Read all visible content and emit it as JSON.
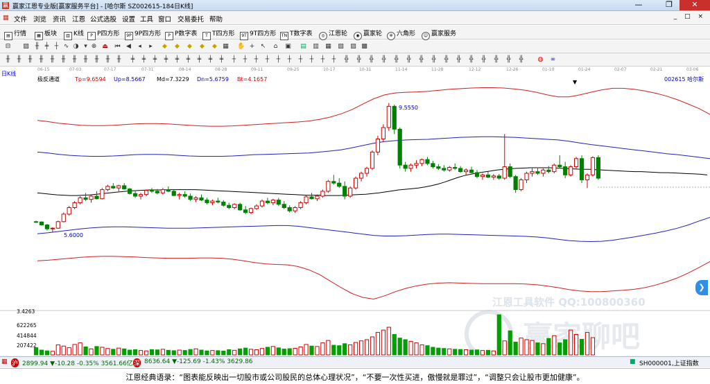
{
  "titlebar": {
    "title": "赢家江恩专业版[赢家服务平台] - [哈尔斯  SZ002615-184日K线]"
  },
  "menubar": {
    "items": [
      "文件",
      "浏览",
      "资讯",
      "江恩",
      "公式选股",
      "设置",
      "工具",
      "窗口",
      "交易委托",
      "帮助"
    ],
    "mdi": "_ □ ×"
  },
  "toolbar1": {
    "items": [
      "行情",
      "板块",
      "K线",
      "P四方形",
      "9P四方形",
      "P数字表",
      "T四方形",
      "9T四方形",
      "T数字表",
      "江恩轮",
      "赢家轮",
      "六角形",
      "赢家服务"
    ]
  },
  "datebar": {
    "dates": [
      "06-15",
      "07-03",
      "07-17",
      "07-31",
      "08-14",
      "08-28",
      "09-11",
      "09-25",
      "10-17",
      "10-31",
      "11-14",
      "11-28",
      "12-12",
      "12-26",
      "01-10",
      "01-24",
      "02-07",
      "02-21",
      "03-06"
    ]
  },
  "period_label": "日K线",
  "chart_data": {
    "type": "candlestick",
    "indicator": {
      "name": "极反通道",
      "params": [
        {
          "label": "Tp",
          "value": "9.6594",
          "color": "#e00000"
        },
        {
          "label": "Up",
          "value": "8.5667",
          "color": "#0000c0"
        },
        {
          "label": "Md",
          "value": "7.3229",
          "color": "#000000"
        },
        {
          "label": "Dn",
          "value": "5.6759",
          "color": "#0000c0"
        },
        {
          "label": "Bt",
          "value": "4.1657",
          "color": "#e00000"
        }
      ]
    },
    "stock_label": "002615 哈尔斯",
    "annotations": {
      "high": "9.5550",
      "low": "5.6000"
    },
    "price_axis": {
      "top": 10.2,
      "bottom": 3.2
    },
    "candles": [
      [
        5.92,
        5.95,
        5.88,
        5.91
      ],
      [
        5.91,
        5.93,
        5.8,
        5.82
      ],
      [
        5.82,
        5.85,
        5.65,
        5.7
      ],
      [
        5.7,
        5.75,
        5.6,
        5.72
      ],
      [
        5.72,
        5.95,
        5.7,
        5.92
      ],
      [
        5.92,
        6.2,
        5.9,
        6.15
      ],
      [
        6.15,
        6.4,
        6.1,
        6.35
      ],
      [
        6.35,
        6.55,
        6.3,
        6.5
      ],
      [
        6.5,
        6.7,
        6.45,
        6.65
      ],
      [
        6.65,
        6.8,
        6.55,
        6.6
      ],
      [
        6.6,
        6.75,
        6.5,
        6.7
      ],
      [
        6.7,
        6.85,
        6.6,
        6.62
      ],
      [
        6.62,
        6.95,
        6.6,
        6.9
      ],
      [
        6.9,
        7.05,
        6.85,
        7.0
      ],
      [
        7.0,
        7.1,
        6.92,
        6.95
      ],
      [
        6.95,
        7.05,
        6.85,
        7.02
      ],
      [
        7.02,
        7.1,
        6.9,
        6.92
      ],
      [
        6.92,
        6.95,
        6.75,
        6.78
      ],
      [
        6.78,
        6.85,
        6.65,
        6.7
      ],
      [
        6.7,
        6.8,
        6.6,
        6.75
      ],
      [
        6.75,
        6.9,
        6.7,
        6.88
      ],
      [
        6.88,
        6.95,
        6.8,
        6.85
      ],
      [
        6.85,
        6.92,
        6.75,
        6.8
      ],
      [
        6.8,
        6.95,
        6.75,
        6.9
      ],
      [
        6.9,
        7.0,
        6.82,
        6.85
      ],
      [
        6.85,
        6.9,
        6.7,
        6.72
      ],
      [
        6.72,
        6.8,
        6.6,
        6.75
      ],
      [
        6.75,
        6.85,
        6.65,
        6.7
      ],
      [
        6.7,
        6.78,
        6.55,
        6.6
      ],
      [
        6.6,
        6.7,
        6.52,
        6.65
      ],
      [
        6.65,
        6.75,
        6.55,
        6.58
      ],
      [
        6.58,
        6.65,
        6.45,
        6.5
      ],
      [
        6.5,
        6.6,
        6.42,
        6.55
      ],
      [
        6.55,
        6.65,
        6.48,
        6.52
      ],
      [
        6.52,
        6.58,
        6.38,
        6.42
      ],
      [
        6.42,
        6.5,
        6.3,
        6.35
      ],
      [
        6.35,
        6.48,
        6.3,
        6.45
      ],
      [
        6.45,
        6.5,
        6.25,
        6.28
      ],
      [
        6.28,
        6.4,
        6.15,
        6.2
      ],
      [
        6.2,
        6.35,
        6.15,
        6.32
      ],
      [
        6.32,
        6.45,
        6.28,
        6.4
      ],
      [
        6.4,
        6.6,
        6.35,
        6.55
      ],
      [
        6.55,
        6.65,
        6.45,
        6.5
      ],
      [
        6.5,
        6.62,
        6.42,
        6.58
      ],
      [
        6.58,
        6.65,
        6.4,
        6.45
      ],
      [
        6.45,
        6.55,
        6.3,
        6.35
      ],
      [
        6.35,
        6.42,
        6.2,
        6.25
      ],
      [
        6.25,
        6.4,
        6.18,
        6.35
      ],
      [
        6.35,
        6.55,
        6.3,
        6.5
      ],
      [
        6.5,
        6.72,
        6.45,
        6.68
      ],
      [
        6.68,
        6.8,
        6.6,
        6.62
      ],
      [
        6.62,
        6.75,
        6.55,
        6.7
      ],
      [
        6.7,
        6.9,
        6.65,
        6.85
      ],
      [
        6.85,
        7.2,
        6.8,
        7.15
      ],
      [
        7.15,
        7.35,
        7.05,
        7.1
      ],
      [
        7.1,
        7.25,
        6.95,
        7.0
      ],
      [
        7.0,
        7.15,
        6.6,
        6.7
      ],
      [
        6.7,
        7.0,
        6.65,
        6.95
      ],
      [
        6.95,
        7.3,
        6.9,
        7.25
      ],
      [
        7.25,
        7.45,
        7.15,
        7.4
      ],
      [
        7.4,
        7.6,
        7.3,
        7.55
      ],
      [
        7.55,
        8.1,
        7.5,
        8.05
      ],
      [
        8.05,
        8.55,
        7.95,
        8.45
      ],
      [
        8.45,
        8.9,
        8.35,
        8.8
      ],
      [
        8.8,
        9.55,
        8.7,
        9.45
      ],
      [
        9.45,
        9.5,
        8.6,
        8.75
      ],
      [
        8.75,
        8.8,
        7.55,
        7.65
      ],
      [
        7.65,
        7.75,
        7.45,
        7.55
      ],
      [
        7.55,
        7.7,
        7.45,
        7.65
      ],
      [
        7.65,
        7.8,
        7.55,
        7.7
      ],
      [
        7.7,
        7.85,
        7.62,
        7.82
      ],
      [
        7.82,
        7.9,
        7.65,
        7.7
      ],
      [
        7.7,
        7.78,
        7.55,
        7.6
      ],
      [
        7.6,
        7.68,
        7.5,
        7.55
      ],
      [
        7.55,
        7.65,
        7.45,
        7.5
      ],
      [
        7.5,
        7.62,
        7.45,
        7.58
      ],
      [
        7.58,
        7.7,
        7.5,
        7.55
      ],
      [
        7.55,
        7.62,
        7.42,
        7.45
      ],
      [
        7.45,
        7.55,
        7.35,
        7.5
      ],
      [
        7.5,
        7.6,
        7.4,
        7.42
      ],
      [
        7.42,
        7.5,
        7.25,
        7.3
      ],
      [
        7.3,
        7.4,
        7.2,
        7.35
      ],
      [
        7.35,
        7.45,
        7.25,
        7.28
      ],
      [
        7.28,
        7.38,
        7.2,
        7.32
      ],
      [
        7.32,
        7.38,
        7.2,
        7.25
      ],
      [
        7.25,
        8.6,
        7.2,
        7.6
      ],
      [
        7.6,
        7.7,
        7.25,
        7.3
      ],
      [
        7.3,
        7.35,
        6.8,
        6.9
      ],
      [
        6.9,
        7.25,
        6.85,
        7.2
      ],
      [
        7.2,
        7.45,
        7.1,
        7.4
      ],
      [
        7.4,
        7.55,
        7.3,
        7.45
      ],
      [
        7.45,
        7.58,
        7.35,
        7.4
      ],
      [
        7.4,
        7.55,
        7.3,
        7.5
      ],
      [
        7.5,
        7.62,
        7.4,
        7.45
      ],
      [
        7.45,
        7.7,
        7.4,
        7.65
      ],
      [
        7.65,
        7.95,
        7.55,
        7.6
      ],
      [
        7.6,
        7.75,
        7.25,
        7.35
      ],
      [
        7.35,
        7.65,
        7.3,
        7.6
      ],
      [
        7.6,
        7.9,
        7.55,
        7.85
      ],
      [
        7.85,
        7.95,
        7.1,
        7.2
      ],
      [
        7.2,
        7.4,
        6.95,
        7.35
      ],
      [
        7.35,
        7.92,
        7.3,
        7.88
      ],
      [
        7.88,
        7.95,
        7.2,
        7.25
      ]
    ],
    "md_line": [
      6.8,
      6.78,
      6.76,
      6.74,
      6.73,
      6.72,
      6.72,
      6.73,
      6.74,
      6.76,
      6.78,
      6.8,
      6.82,
      6.84,
      6.86,
      6.87,
      6.88,
      6.89,
      6.89,
      6.89,
      6.9,
      6.9,
      6.9,
      6.9,
      6.9,
      6.89,
      6.88,
      6.87,
      6.86,
      6.85,
      6.84,
      6.83,
      6.82,
      6.81,
      6.8,
      6.79,
      6.78,
      6.77,
      6.76,
      6.75,
      6.74,
      6.73,
      6.73,
      6.73,
      6.72,
      6.72,
      6.72,
      6.73,
      6.74,
      6.75,
      6.76,
      6.78,
      6.8,
      6.83,
      6.86,
      6.89,
      6.91,
      6.93,
      6.95,
      6.98,
      7.02,
      7.07,
      7.13,
      7.2,
      7.27,
      7.33,
      7.37,
      7.41,
      7.44,
      7.47,
      7.5,
      7.52,
      7.54,
      7.55,
      7.56,
      7.57,
      7.57,
      7.57,
      7.57,
      7.56,
      7.55,
      7.54,
      7.53,
      7.52,
      7.52,
      7.51,
      7.5,
      7.49,
      7.48,
      7.47,
      7.46,
      7.45,
      7.45,
      7.44,
      7.43,
      7.42,
      7.42,
      7.41,
      7.4,
      7.39,
      7.38,
      7.37,
      7.35
    ],
    "up_line": [
      8.05,
      8.02,
      7.98,
      7.95,
      7.93,
      7.92,
      7.92,
      7.93,
      7.95,
      7.97,
      7.98,
      7.98,
      7.97,
      7.95,
      7.93,
      7.92,
      7.92,
      7.92,
      7.93,
      7.95,
      7.97,
      7.98,
      7.99,
      8.0,
      8.01,
      8.02,
      8.05,
      8.08,
      8.12,
      8.18,
      8.25,
      8.32,
      8.37,
      8.4,
      8.42,
      8.43,
      8.44,
      8.46,
      8.48,
      8.5,
      8.51,
      8.52,
      8.52,
      8.51,
      8.5,
      8.48,
      8.46,
      8.44,
      8.42,
      8.38,
      8.33,
      8.28,
      8.24,
      8.2,
      8.16,
      8.12,
      8.08,
      8.04,
      8.0,
      7.97,
      7.93,
      7.89,
      7.85
    ],
    "dn_line": [
      5.55,
      5.58,
      5.62,
      5.66,
      5.7,
      5.73,
      5.75,
      5.76,
      5.76,
      5.75,
      5.74,
      5.73,
      5.72,
      5.72,
      5.72,
      5.73,
      5.74,
      5.75,
      5.76,
      5.77,
      5.78,
      5.79,
      5.8,
      5.8,
      5.78,
      5.74,
      5.7,
      5.66,
      5.62,
      5.58,
      5.54,
      5.5,
      5.48,
      5.48,
      5.49,
      5.51,
      5.53,
      5.54,
      5.54,
      5.53,
      5.52,
      5.51,
      5.5,
      5.49,
      5.48,
      5.47,
      5.45,
      5.42,
      5.38,
      5.34,
      5.32,
      5.31,
      5.32,
      5.35,
      5.4,
      5.45,
      5.51,
      5.57,
      5.64,
      5.72,
      5.82,
      5.94,
      6.05
    ],
    "tp_line": [
      9.02,
      8.98,
      8.93,
      8.9,
      8.87,
      8.86,
      8.86,
      8.87,
      8.89,
      8.91,
      8.92,
      8.92,
      8.91,
      8.89,
      8.87,
      8.85,
      8.84,
      8.84,
      8.85,
      8.87,
      8.89,
      8.91,
      8.93,
      8.95,
      8.97,
      9.0,
      9.05,
      9.12,
      9.22,
      9.35,
      9.52,
      9.68,
      9.8,
      9.86,
      9.88,
      9.89,
      9.91,
      9.94,
      9.97,
      9.99,
      10.01,
      10.02,
      10.02,
      10.01,
      9.98,
      9.94,
      9.88,
      9.8,
      9.74,
      9.74,
      9.8,
      9.88,
      9.95,
      10.0,
      10.0,
      9.97,
      9.92,
      9.85,
      9.76,
      9.65,
      9.52,
      9.38,
      9.2
    ],
    "bt_line": [
      4.72,
      4.74,
      4.77,
      4.8,
      4.83,
      4.85,
      4.86,
      4.86,
      4.85,
      4.84,
      4.82,
      4.81,
      4.8,
      4.8,
      4.8,
      4.81,
      4.81,
      4.8,
      4.77,
      4.72,
      4.67,
      4.63,
      4.61,
      4.6,
      4.55,
      4.45,
      4.3,
      4.1,
      3.9,
      3.72,
      3.6,
      3.55,
      3.65,
      3.78,
      3.88,
      3.96,
      4.01,
      4.04,
      4.05,
      4.04,
      4.03,
      4.02,
      4.02,
      4.02,
      4.02,
      4.01,
      3.99,
      3.95,
      3.9,
      3.84,
      3.8,
      3.78,
      3.78,
      3.8,
      3.82,
      3.85,
      3.9,
      3.98,
      4.08,
      4.2,
      4.35,
      4.52,
      4.7
    ],
    "volume_axis": {
      "labels": [
        "3.4263",
        "622265",
        "414844",
        "207422"
      ]
    },
    "volumes": [
      180000,
      120000,
      100000,
      90000,
      250000,
      220000,
      180000,
      260000,
      300000,
      200000,
      150000,
      210000,
      190000,
      160000,
      140000,
      170000,
      150000,
      120000,
      130000,
      110000,
      100000,
      130000,
      125000,
      140000,
      115000,
      105000,
      120000,
      110000,
      135000,
      150000,
      120000,
      100000,
      110000,
      105000,
      95000,
      130000,
      115000,
      150000,
      170000,
      140000,
      130000,
      160000,
      190000,
      210000,
      175000,
      145000,
      155000,
      165000,
      200000,
      260000,
      220000,
      210000,
      300000,
      360000,
      240000,
      230000,
      280000,
      250000,
      310000,
      350000,
      380000,
      450000,
      560000,
      620000,
      690000,
      510000,
      420000,
      380000,
      340000,
      300000,
      250000,
      230000,
      190000,
      170000,
      160000,
      150000,
      140000,
      135000,
      130000,
      120000,
      125000,
      110000,
      115000,
      100000,
      1000000,
      350000,
      600000,
      320000,
      420000,
      380000,
      360000,
      300000,
      280000,
      410000,
      480000,
      300000,
      380000,
      620000,
      510000,
      390000,
      560000,
      430000
    ],
    "watermark": {
      "line1": "江恩工具软件  QQ:100800360",
      "line2": "赢家聊吧"
    }
  },
  "statusbar": {
    "sh": "2899.94 ▼-10.28 -0.35% 3561.66亿",
    "sz": "8636.64 ▼-125.69 -1.43% 3629.86",
    "right": "SH000001,上证指数"
  },
  "quote": {
    "text": "江恩经典语录：“图表能反映出一切股市或公司股民的总体心理状况”，“不要一次性买进，傲慢就是罪过”，“调整只会让股市更加健康”。"
  }
}
